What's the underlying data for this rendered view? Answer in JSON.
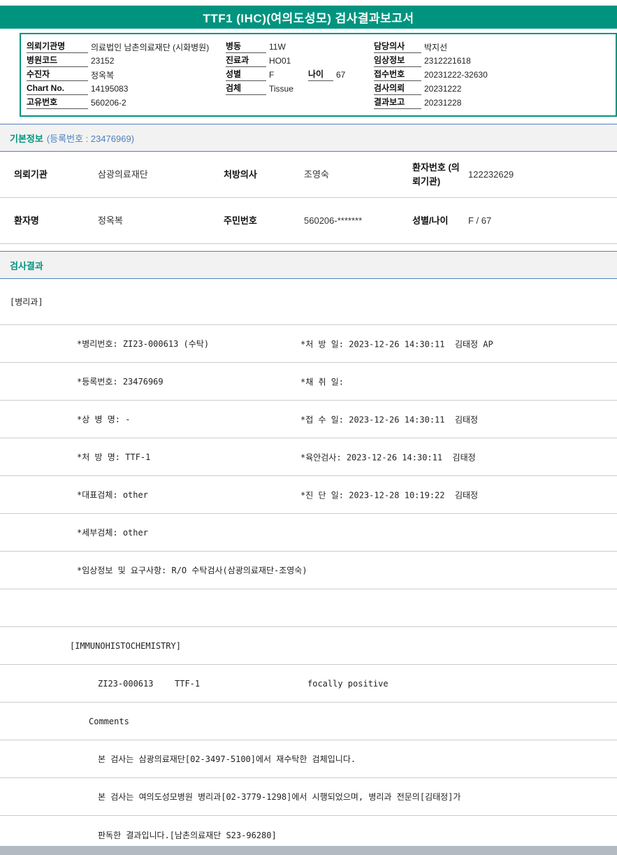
{
  "title": "TTF1 (IHC)(여의도성모) 검사결과보고서",
  "colors": {
    "banner_teal": "#00947F",
    "section_border_blue": "#4F81BD",
    "section_bg": "#F2F2F2",
    "separator_gray": "#CCCCCC",
    "bottom_bar_gray": "#B3BAC1"
  },
  "header_info": {
    "left": [
      {
        "label": "의뢰기관명",
        "value": "의료법인 남촌의료재단 (시화병원)"
      },
      {
        "label": "병원코드",
        "value": "23152"
      },
      {
        "label": "수진자",
        "value": "정옥복"
      },
      {
        "label": "Chart No.",
        "value": "14195083"
      },
      {
        "label": "고유번호",
        "value": "560206-2"
      }
    ],
    "middle": [
      {
        "label": "병동",
        "value": "11W"
      },
      {
        "label": "진료과",
        "value": "HO01"
      },
      {
        "label": "성별",
        "value": "F"
      },
      {
        "label": "검체",
        "value": "Tissue"
      }
    ],
    "age": {
      "label": "나이",
      "value": "67"
    },
    "right": [
      {
        "label": "담당의사",
        "value": "박지선"
      },
      {
        "label": "임상정보",
        "value": "2312221618"
      },
      {
        "label": "접수번호",
        "value": "20231222-32630"
      },
      {
        "label": "검사의뢰",
        "value": "20231222"
      },
      {
        "label": "결과보고",
        "value": "20231228"
      }
    ]
  },
  "basic_info": {
    "title": "기본정보",
    "subtitle": "(등록번호 : 23476969)",
    "rows": [
      {
        "l1": "의뢰기관",
        "v1": "삼광의료재단",
        "l2": "처방의사",
        "v2": "조영숙",
        "l3": "환자번호 (의뢰기관)",
        "v3": "122232629"
      },
      {
        "l1": "환자명",
        "v1": "정옥복",
        "l2": "주민번호",
        "v2": "560206-*******",
        "l3": "성별/나이",
        "v3": "F / 67"
      }
    ]
  },
  "results": {
    "title": "검사결과",
    "department": "[병리과]",
    "rows": [
      {
        "left": "*병리번호: ZI23-000613 (수탁)",
        "right": "*처 방 일: 2023-12-26 14:30:11  김태정 AP"
      },
      {
        "left": "*등록번호: 23476969",
        "right": "*채 취 일:"
      },
      {
        "left": "*상 병 명: -",
        "right": "*접 수 일: 2023-12-26 14:30:11  김태정"
      },
      {
        "left": "*처 방 명: TTF-1",
        "right": "*육안검사: 2023-12-26 14:30:11  김태정"
      },
      {
        "left": "*대표검체: other",
        "right": "*진 단 일: 2023-12-28 10:19:22  김태정"
      },
      {
        "left": "*세부검체: other",
        "right": ""
      },
      {
        "left": "*임상정보 및 요구사항: R/O 수탁검사(삼광의료재단-조영숙)",
        "right": ""
      }
    ],
    "ihc_header": "[IMMUNOHISTOCHEMISTRY]",
    "ihc_row": {
      "specimen_no": "ZI23-000613",
      "test_name": "TTF-1",
      "result": "focally positive"
    },
    "comments_label": "Comments",
    "comment_lines": [
      "본 검사는 삼광의료재단[02-3497-5100]에서 재수탁한 검체입니다.",
      "본 검사는 여의도성모병원 병리과[02-3779-1298]에서 시행되었으며, 병리과 전문의[김태정]가",
      "판독한 결과입니다.[남촌의료재단 S23-96280]"
    ]
  }
}
